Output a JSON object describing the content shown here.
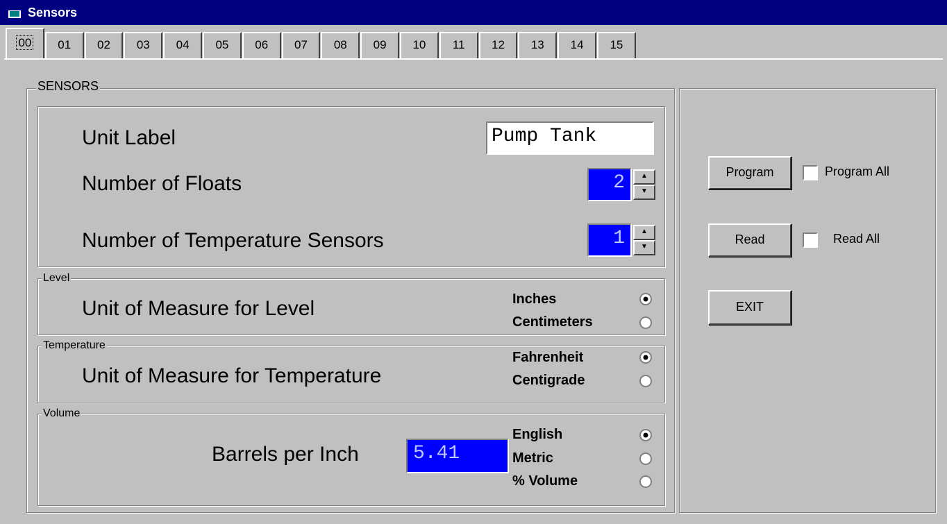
{
  "window": {
    "title": "Sensors"
  },
  "tabs": [
    "00",
    "01",
    "02",
    "03",
    "04",
    "05",
    "06",
    "07",
    "08",
    "09",
    "10",
    "11",
    "12",
    "13",
    "14",
    "15"
  ],
  "selected_tab": "00",
  "sensors": {
    "legend": "SENSORS",
    "unit_label": {
      "label": "Unit Label",
      "value": "Pump Tank"
    },
    "num_floats": {
      "label": "Number of Floats",
      "value": "2"
    },
    "num_temp": {
      "label": "Number of Temperature Sensors",
      "value": "1"
    }
  },
  "level": {
    "legend": "Level",
    "label": "Unit of Measure for Level",
    "options": [
      "Inches",
      "Centimeters"
    ],
    "selected": "Inches"
  },
  "temperature": {
    "legend": "Temperature",
    "label": "Unit of Measure for Temperature",
    "options": [
      "Fahrenheit",
      "Centigrade"
    ],
    "selected": "Fahrenheit"
  },
  "volume": {
    "legend": "Volume",
    "label": "Barrels per Inch",
    "value": "5.41",
    "options": [
      "English",
      "Metric",
      "% Volume"
    ],
    "selected": "English"
  },
  "actions": {
    "program": "Program",
    "program_all": "Program All",
    "read": "Read",
    "read_all": "Read All",
    "exit": "EXIT"
  }
}
